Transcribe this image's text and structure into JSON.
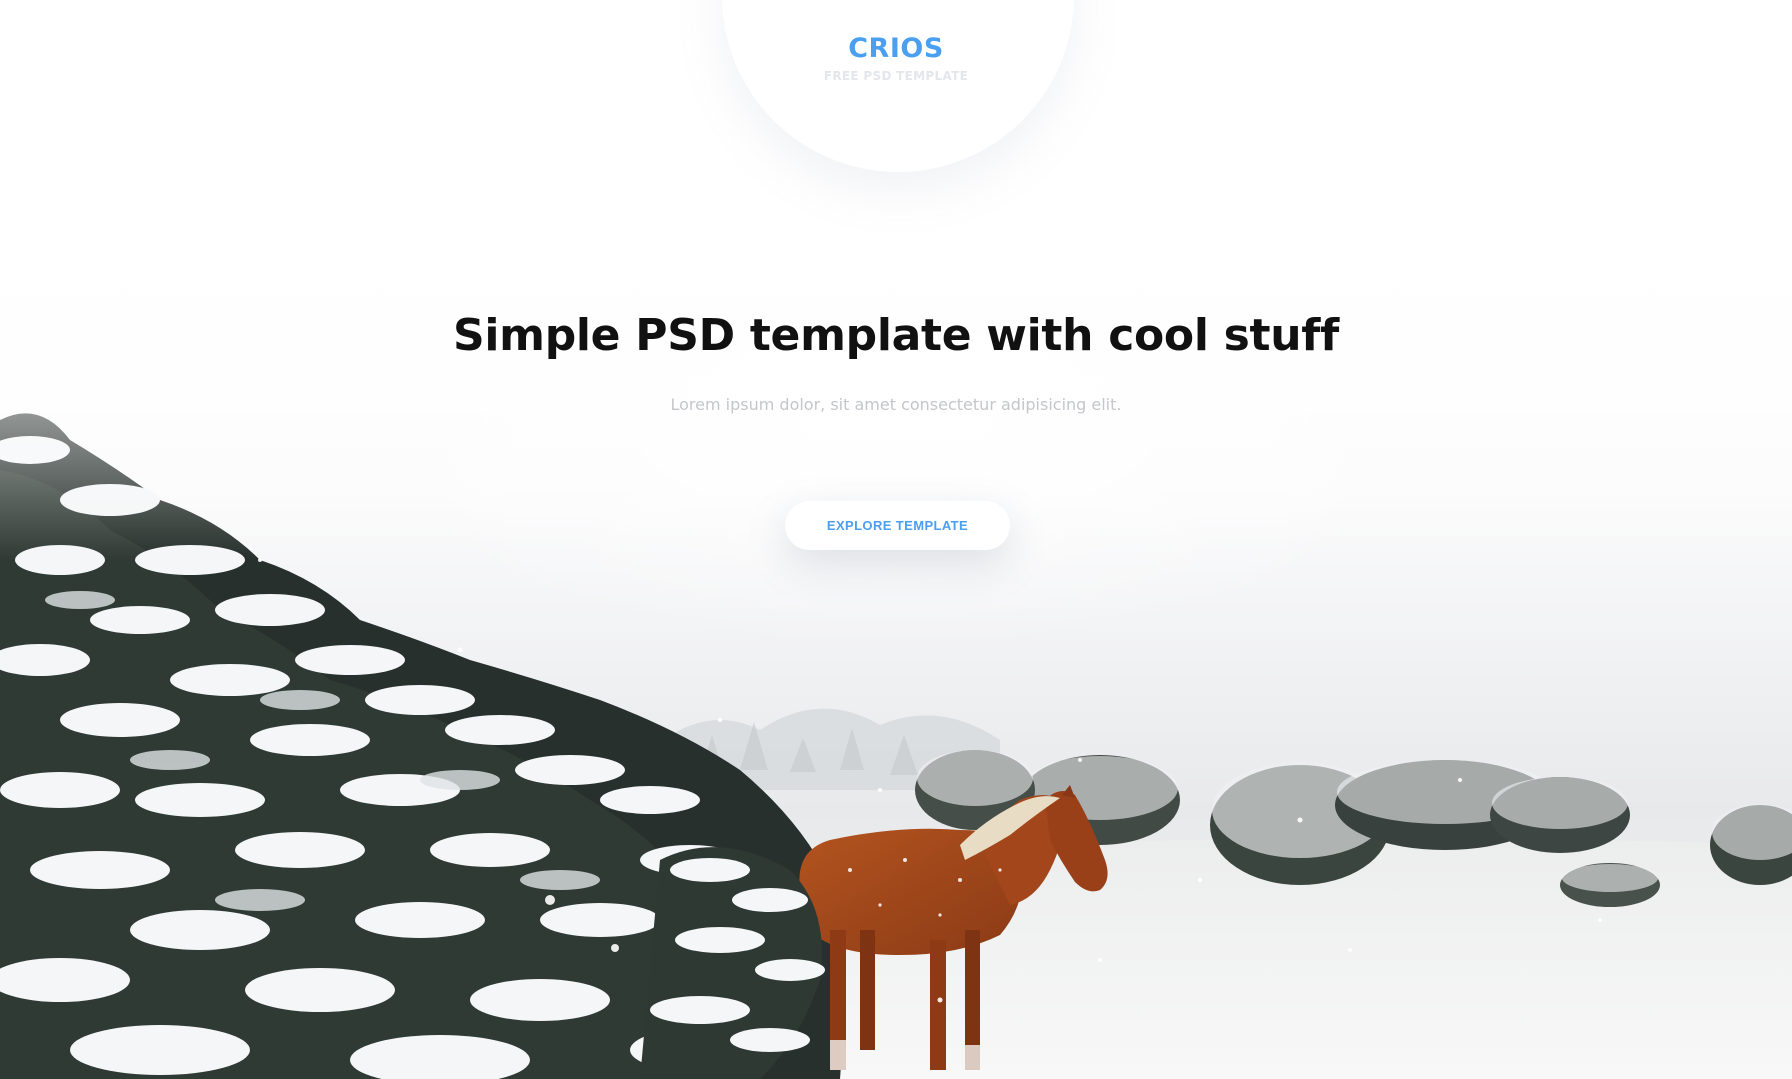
{
  "logo": {
    "title": "CRIOS",
    "subtitle": "FREE PSD TEMPLATE"
  },
  "hero": {
    "title": "Simple PSD template with cool stuff",
    "subtitle": "Lorem ipsum dolor, sit amet consectetur adipisicing elit.",
    "cta_label": "EXPLORE TEMPLATE"
  },
  "background": {
    "scene": "snowy-landscape-with-horse"
  },
  "colors": {
    "accent": "#4a9ff0",
    "logo_subtitle": "#e3e6ea",
    "heading": "#111111",
    "subtext": "#c4c6ca",
    "button_bg": "#ffffff",
    "horse": "#a4461c",
    "horse_mane": "#e9dcc5",
    "bush_dark": "#2c3430"
  }
}
